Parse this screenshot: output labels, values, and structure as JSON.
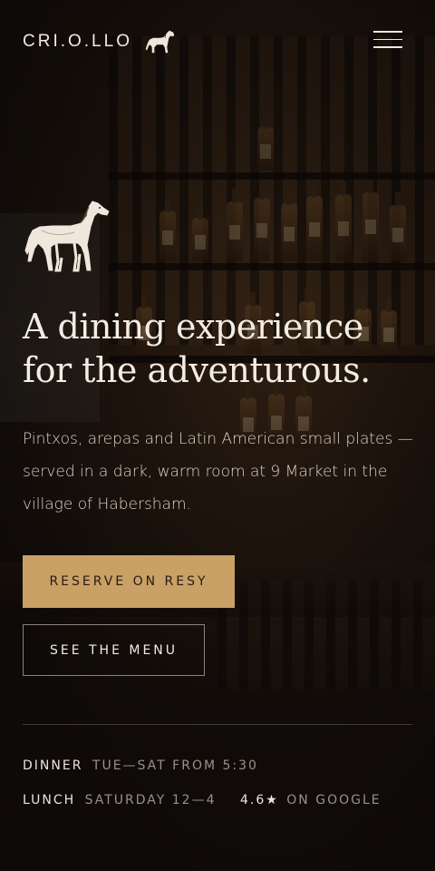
{
  "brand": {
    "name": "CRI.O.LLO"
  },
  "nav": {
    "menu_icon": "hamburger-menu-icon"
  },
  "hero": {
    "headline_line1": "A dining experience",
    "headline_line2": "for the adventurous.",
    "description": "Pintxos, arepas and Latin American small plates — served in a dark, warm room at 9 Market in the village of Habersham."
  },
  "actions": {
    "reserve_label": "RESERVE ON RESY",
    "menu_label": "SEE THE MENU"
  },
  "hours": {
    "dinner_label": "DINNER",
    "dinner_value": "TUE—SAT FROM 5:30",
    "lunch_label": "LUNCH",
    "lunch_value": "SATURDAY 12—4"
  },
  "rating": {
    "score": "4.6★",
    "source": "ON GOOGLE"
  },
  "colors": {
    "accent": "#c9a066",
    "background": "#140f0c",
    "text": "#f3ece2",
    "muted": "#9a9087"
  }
}
